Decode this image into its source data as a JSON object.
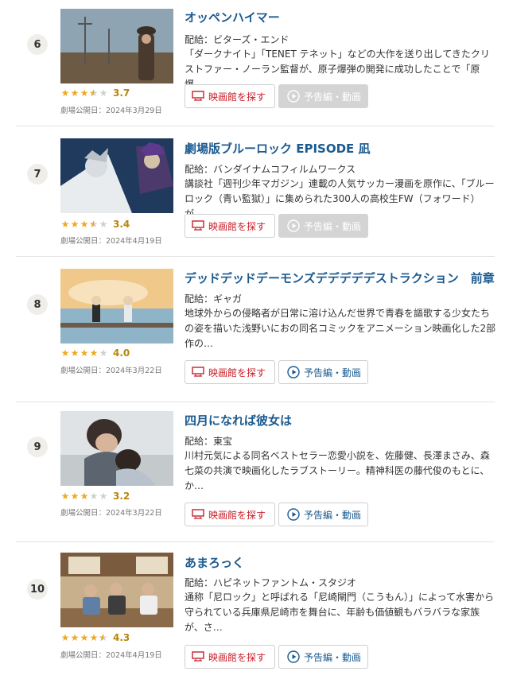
{
  "colors": {
    "link_blue": "#1b5a8f",
    "accent_red": "#c8202a",
    "star_gold": "#f0a820",
    "disabled_gray": "#d4d4d4"
  },
  "buttons": {
    "theater_label": "映画館を探す",
    "trailer_label": "予告編・動画",
    "theater_icon": "screen-icon",
    "trailer_icon": "play-circle-icon"
  },
  "movies": [
    {
      "rank": "6",
      "title": "オッペンハイマー",
      "distributor": "配給：ビターズ・エンド",
      "description": "「ダークナイト」「TENET テネット」などの大作を送り出してきたクリストファー・ノーラン監督が、原子爆弾の開発に成功したことで「原爆…",
      "rating": 3.7,
      "rating_text": "3.7",
      "release": "劇場公開日：2024年3月29日",
      "trailer_available": false
    },
    {
      "rank": "7",
      "title": "劇場版ブルーロック EPISODE 凪",
      "distributor": "配給：バンダイナムコフィルムワークス",
      "description": "講談社「週刊少年マガジン」連載の人気サッカー漫画を原作に、「ブルーロック（青い監獄）」に集められた300人の高校生FW（フォワード）が…",
      "rating": 3.4,
      "rating_text": "3.4",
      "release": "劇場公開日：2024年4月19日",
      "trailer_available": false
    },
    {
      "rank": "8",
      "title": "デッドデッドデーモンズデデデデデストラクション　前章",
      "distributor": "配給：ギャガ",
      "description": "地球外からの侵略者が日常に溶け込んだ世界で青春を謳歌する少女たちの姿を描いた浅野いにおの同名コミックをアニメーション映画化した2部作の…",
      "rating": 4.0,
      "rating_text": "4.0",
      "release": "劇場公開日：2024年3月22日",
      "trailer_available": true
    },
    {
      "rank": "9",
      "title": "四月になれば彼女は",
      "distributor": "配給：東宝",
      "description": "川村元気による同名ベストセラー恋愛小説を、佐藤健、長澤まさみ、森七菜の共演で映画化したラブストーリー。精神科医の藤代俊のもとに、か…",
      "rating": 3.2,
      "rating_text": "3.2",
      "release": "劇場公開日：2024年3月22日",
      "trailer_available": true
    },
    {
      "rank": "10",
      "title": "あまろっく",
      "distributor": "配給：ハピネットファントム・スタジオ",
      "description": "通称「尼ロック」と呼ばれる「尼崎閘門（こうもん）」によって水害から守られている兵庫県尼崎市を舞台に、年齢も価値観もバラバラな家族が、さ…",
      "rating": 4.3,
      "rating_text": "4.3",
      "release": "劇場公開日：2024年4月19日",
      "trailer_available": true
    }
  ]
}
